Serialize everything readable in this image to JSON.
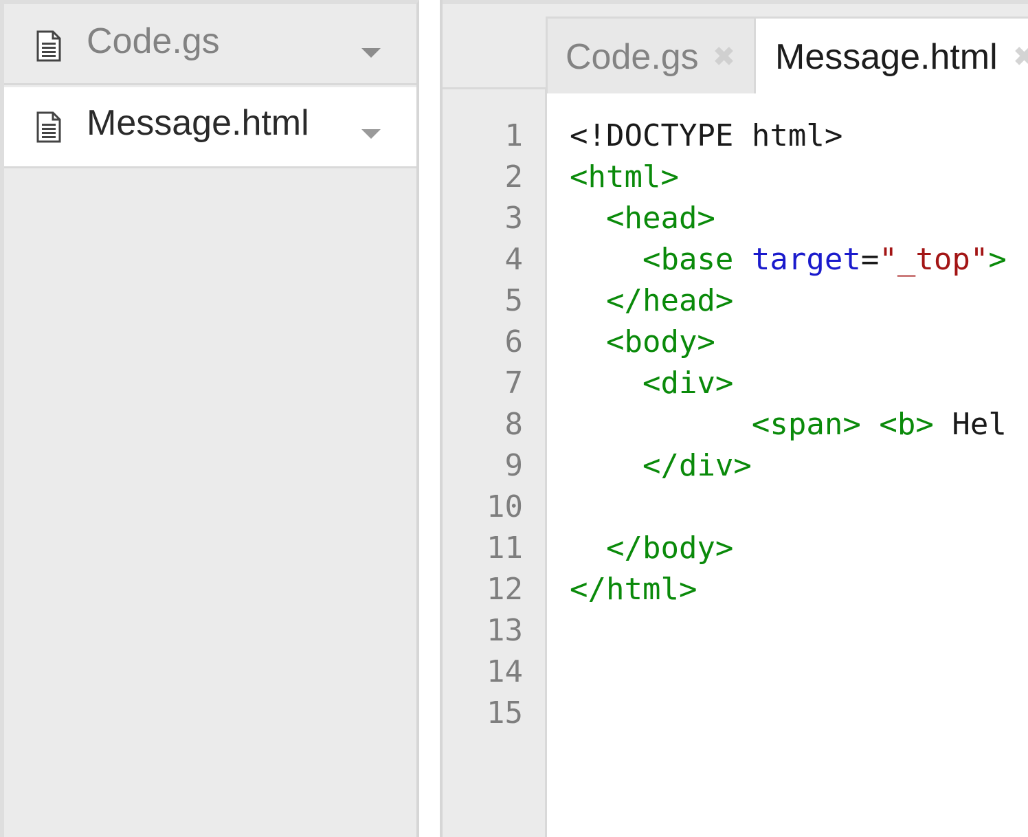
{
  "sidebar": {
    "files": [
      {
        "name": "Code.gs",
        "icon": "file-document-icon",
        "menu_icon": "caret-down-icon",
        "selected": false
      },
      {
        "name": "Message.html",
        "icon": "file-document-icon",
        "menu_icon": "caret-down-icon",
        "selected": true
      }
    ]
  },
  "editor": {
    "tabs": [
      {
        "label": "Code.gs",
        "close": "✖",
        "active": false
      },
      {
        "label": "Message.html",
        "close": "✖",
        "active": true
      }
    ],
    "line_numbers": [
      "1",
      "2",
      "3",
      "4",
      "5",
      "6",
      "7",
      "8",
      "9",
      "10",
      "11",
      "12",
      "13",
      "14",
      "15"
    ],
    "code_lines": [
      [
        {
          "text": "<!DOCTYPE html>",
          "kind": "plain"
        }
      ],
      [
        {
          "text": "<html>",
          "kind": "tag"
        }
      ],
      [
        {
          "text": "  ",
          "kind": "plain"
        },
        {
          "text": "<head>",
          "kind": "tag"
        }
      ],
      [
        {
          "text": "    ",
          "kind": "plain"
        },
        {
          "text": "<base ",
          "kind": "tag"
        },
        {
          "text": "target",
          "kind": "attr"
        },
        {
          "text": "=",
          "kind": "plain"
        },
        {
          "text": "\"_top\"",
          "kind": "str"
        },
        {
          "text": ">",
          "kind": "tag"
        }
      ],
      [
        {
          "text": "  ",
          "kind": "plain"
        },
        {
          "text": "</head>",
          "kind": "tag"
        }
      ],
      [
        {
          "text": "  ",
          "kind": "plain"
        },
        {
          "text": "<body>",
          "kind": "tag"
        }
      ],
      [
        {
          "text": "    ",
          "kind": "plain"
        },
        {
          "text": "<div>",
          "kind": "tag"
        }
      ],
      [
        {
          "text": "          ",
          "kind": "plain"
        },
        {
          "text": "<span>",
          "kind": "tag"
        },
        {
          "text": " ",
          "kind": "plain"
        },
        {
          "text": "<b>",
          "kind": "tag"
        },
        {
          "text": " Hel",
          "kind": "plain"
        }
      ],
      [
        {
          "text": "    ",
          "kind": "plain"
        },
        {
          "text": "</div>",
          "kind": "tag"
        }
      ],
      [
        {
          "text": "",
          "kind": "plain"
        }
      ],
      [
        {
          "text": "  ",
          "kind": "plain"
        },
        {
          "text": "</body>",
          "kind": "tag"
        }
      ],
      [
        {
          "text": "</html>",
          "kind": "tag"
        }
      ],
      [
        {
          "text": "",
          "kind": "plain"
        }
      ],
      [
        {
          "text": "",
          "kind": "plain"
        }
      ],
      [
        {
          "text": "",
          "kind": "plain"
        }
      ]
    ]
  },
  "colors": {
    "tag": "#0a8a0a",
    "attr": "#1a1acc",
    "string": "#a31515",
    "plain": "#1a1a1a",
    "sidebar_bg": "#ebebeb",
    "gutter_text": "#7e7e7e"
  }
}
